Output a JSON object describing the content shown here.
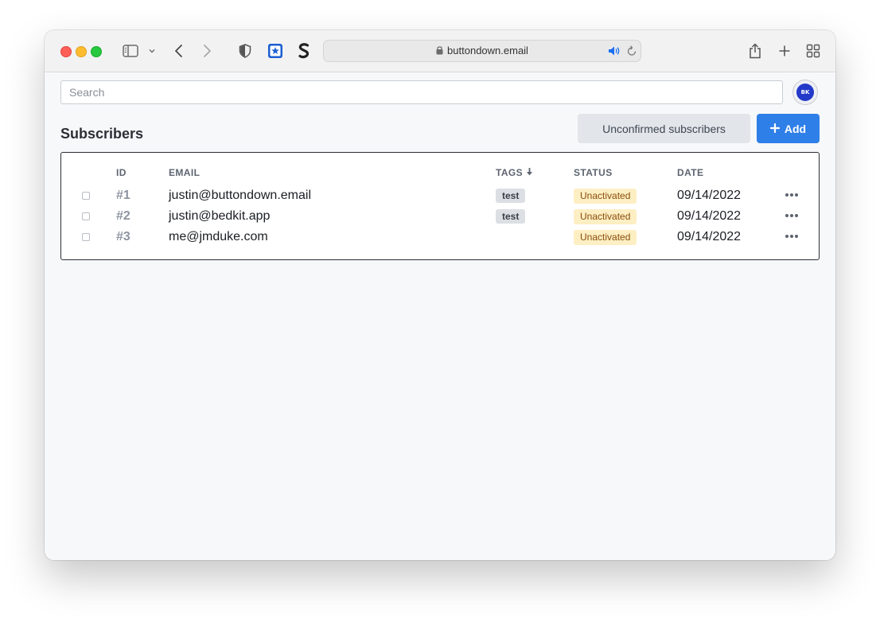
{
  "browser": {
    "url": "buttondown.email"
  },
  "search": {
    "placeholder": "Search"
  },
  "avatar": {
    "initials": "BK"
  },
  "page": {
    "title": "Subscribers",
    "unconfirmed_label": "Unconfirmed subscribers",
    "add_label": "Add"
  },
  "table": {
    "headers": {
      "id": "ID",
      "email": "EMAIL",
      "tags": "TAGS",
      "status": "STATUS",
      "date": "DATE"
    },
    "rows": [
      {
        "id": "#1",
        "email": "justin@buttondown.email",
        "tag": "test",
        "status": "Unactivated",
        "date": "09/14/2022"
      },
      {
        "id": "#2",
        "email": "justin@bedkit.app",
        "tag": "test",
        "status": "Unactivated",
        "date": "09/14/2022"
      },
      {
        "id": "#3",
        "email": "me@jmduke.com",
        "tag": "",
        "status": "Unactivated",
        "date": "09/14/2022"
      }
    ]
  },
  "colors": {
    "accent": "#2f7fe8",
    "status_bg": "#fdefc3",
    "status_text": "#8a4c0b"
  },
  "icons": {
    "sidebar": "sidebar-icon",
    "back": "chevron-left-icon",
    "forward": "chevron-right-icon",
    "lock": "lock-icon",
    "sound": "speaker-icon",
    "reload": "reload-icon",
    "share": "share-icon",
    "new_tab": "plus-icon",
    "tab_overview": "grid-icon",
    "sort": "arrow-down-icon",
    "more": "more-horizontal-icon"
  }
}
